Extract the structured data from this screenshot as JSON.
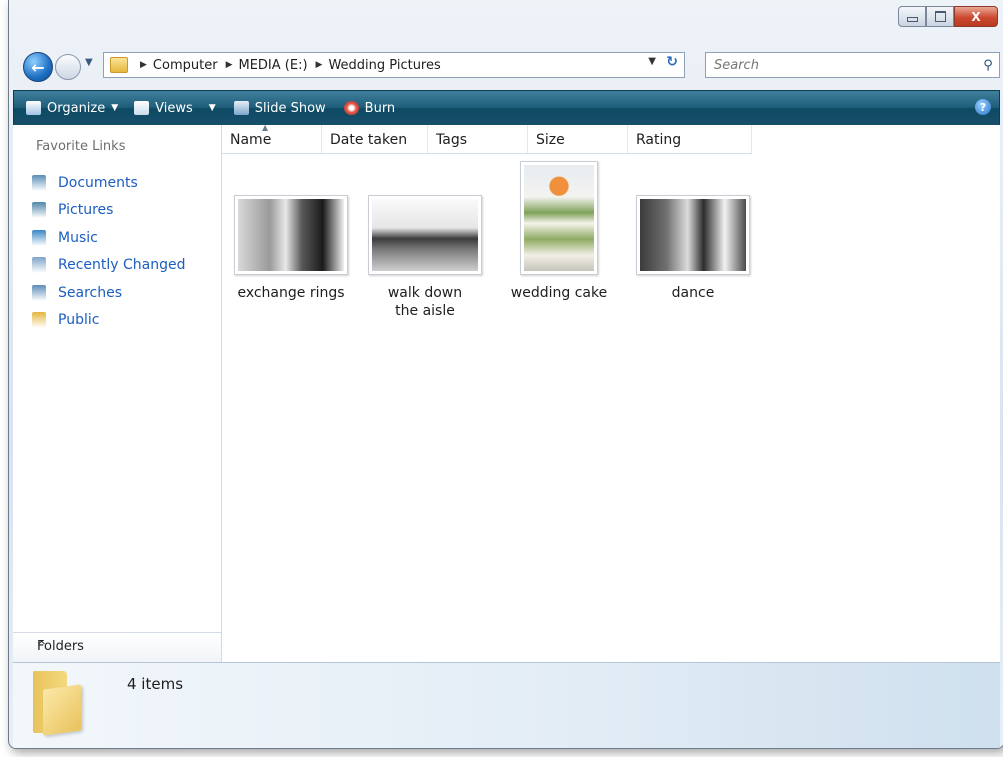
{
  "window": {
    "caption_buttons": {
      "minimize_icon": "minimize-icon",
      "maximize_icon": "maximize-icon",
      "close_label": "X"
    }
  },
  "address": {
    "crumbs": [
      "Computer",
      "MEDIA (E:)",
      "Wedding Pictures"
    ],
    "search_placeholder": "Search"
  },
  "toolbar": {
    "organize_label": "Organize",
    "views_label": "Views",
    "slideshow_label": "Slide Show",
    "burn_label": "Burn",
    "help_label": "?"
  },
  "nav": {
    "title": "Favorite Links",
    "items": [
      {
        "label": "Documents",
        "icon": "documents-icon",
        "color": "#5a8fb6"
      },
      {
        "label": "Pictures",
        "icon": "pictures-icon",
        "color": "#4f86a6"
      },
      {
        "label": "Music",
        "icon": "music-icon",
        "color": "#3a86c4"
      },
      {
        "label": "Recently Changed",
        "icon": "recently-changed-icon",
        "color": "#7fa3c9"
      },
      {
        "label": "Searches",
        "icon": "searches-icon",
        "color": "#5d8db8"
      },
      {
        "label": "Public",
        "icon": "public-folder-icon",
        "color": "#e5b63d"
      }
    ],
    "folders_label": "Folders",
    "folders_chevron": "^"
  },
  "columns": [
    {
      "label": "Name",
      "sorted": true
    },
    {
      "label": "Date taken"
    },
    {
      "label": "Tags"
    },
    {
      "label": "Size"
    },
    {
      "label": "Rating"
    }
  ],
  "files": [
    {
      "name": "exchange rings",
      "thumb": "bw-photo-hands"
    },
    {
      "name": "walk down the aisle",
      "thumb": "bw-photo-crowd"
    },
    {
      "name": "wedding cake",
      "thumb": "color-photo-cake"
    },
    {
      "name": "dance",
      "thumb": "bw-photo-dance"
    }
  ],
  "details": {
    "count_label": "4 items"
  },
  "colors": {
    "toolbar": "#1f5e7a",
    "link": "#1b5ec0",
    "close_button": "#cc4a32"
  }
}
